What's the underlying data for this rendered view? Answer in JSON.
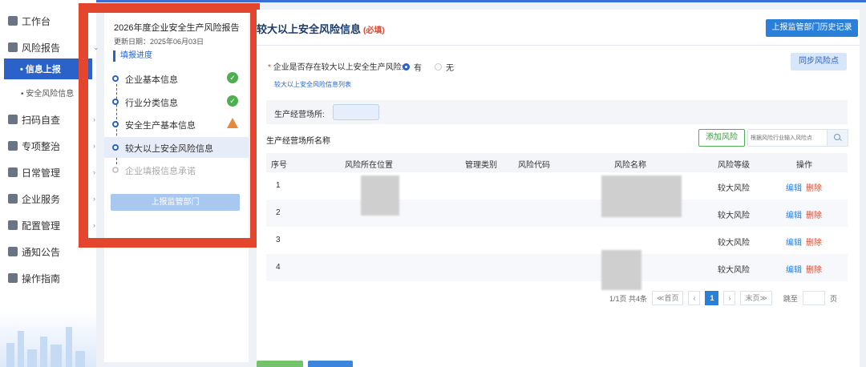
{
  "nav": {
    "items": [
      {
        "label": "工作台",
        "icon": "dashboard-icon"
      },
      {
        "label": "风险报告",
        "icon": "report-icon"
      },
      {
        "label": "扫码自查",
        "icon": "scan-icon"
      },
      {
        "label": "专项整治",
        "icon": "warning-icon"
      },
      {
        "label": "日常管理",
        "icon": "calendar-icon"
      },
      {
        "label": "企业服务",
        "icon": "grid-icon"
      },
      {
        "label": "配置管理",
        "icon": "settings-icon"
      },
      {
        "label": "通知公告",
        "icon": "notice-icon"
      },
      {
        "label": "操作指南",
        "icon": "book-icon"
      }
    ],
    "active_label": "• 信息上报",
    "sub_label": "• 安全风险信息"
  },
  "progress": {
    "title": "2026年度企业安全生产风险报告",
    "date": "更新日期：2025年06月03日",
    "section": "填报进度",
    "steps": [
      {
        "label": "企业基本信息",
        "status": "done"
      },
      {
        "label": "行业分类信息",
        "status": "done"
      },
      {
        "label": "安全生产基本信息",
        "status": "warning"
      },
      {
        "label": "较大以上安全风险信息",
        "status": "active"
      },
      {
        "label": "企业填报信息承诺",
        "status": "pending"
      }
    ],
    "submit_label": "上报监管部门"
  },
  "main": {
    "title": "较大以上安全风险信息",
    "required": "(必填)",
    "history_button": "上报监管部门历史记录",
    "question": "企业是否存在较大以上安全生产风险:",
    "question_star": "*",
    "option_yes": "有",
    "option_no": "无",
    "sync_button": "同步风险点",
    "list_link": "较大以上安全风险信息列表",
    "site_label": "生产经营场所:",
    "site_name_label": "生产经营场所名称",
    "add_button": "添加风险",
    "search_placeholder": "根据风险行业输入风险点",
    "table": {
      "headers": [
        "序号",
        "风险所在位置",
        "管理类别",
        "风险代码",
        "风险名称",
        "风险等级",
        "操作"
      ],
      "rows": [
        {
          "no": "1",
          "level": "较大风险",
          "edit": "编辑",
          "del": "删除"
        },
        {
          "no": "2",
          "level": "较大风险",
          "edit": "编辑",
          "del": "删除"
        },
        {
          "no": "3",
          "level": "较大风险",
          "edit": "编辑",
          "del": "删除"
        },
        {
          "no": "4",
          "level": "较大风险",
          "edit": "编辑",
          "del": "删除"
        }
      ]
    },
    "pager": {
      "summary": "1/1页 共4条",
      "first": "≪首页",
      "prev": "‹",
      "current": "1",
      "next": "›",
      "last": "末页≫",
      "jump_label": "跳至",
      "page_unit": "页"
    }
  },
  "colors": {
    "accent": "#2a62c9",
    "highlight_frame": "#e3462d",
    "done": "#4caf50",
    "warning": "#e6893b"
  }
}
